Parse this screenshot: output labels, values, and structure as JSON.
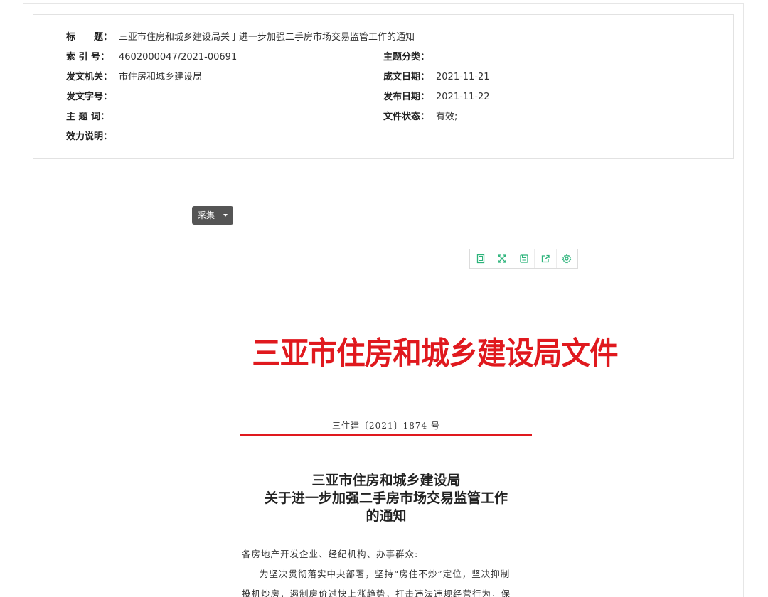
{
  "meta": {
    "title_label": "标　　题：",
    "title_value": "三亚市住房和城乡建设局关于进一步加强二手房市场交易监管工作的通知",
    "index_label": "索 引 号：",
    "index_value": "4602000047/2021-00691",
    "category_label": "主题分类：",
    "category_value": "",
    "issuer_label": "发文机关：",
    "issuer_value": "市住房和城乡建设局",
    "created_label": "成文日期：",
    "created_value": "2021-11-21",
    "docno_label": "发文字号：",
    "docno_value": "",
    "published_label": "发布日期：",
    "published_value": "2021-11-22",
    "keywords_label": "主 题 词：",
    "keywords_value": "",
    "status_label": "文件状态：",
    "status_value": "有效;",
    "validity_label": "效力说明：",
    "validity_value": ""
  },
  "collect_button": {
    "label": "采集"
  },
  "toolbar": {
    "icons": [
      "page-icon",
      "fullscreen-icon",
      "save-icon",
      "share-icon",
      "settings-icon"
    ],
    "accent_color": "#2bb37a"
  },
  "document": {
    "header": "三亚市住房和城乡建设局文件",
    "number": "三住建〔2021〕1874 号",
    "title_line1": "三亚市住房和城乡建设局",
    "title_line2": "关于进一步加强二手房市场交易监管工作",
    "title_line3": "的通知",
    "salutation": "各房地产开发企业、经纪机构、办事群众:",
    "body_line1": "为坚决贯彻落实中央部署，坚持“房住不炒”定位，坚决抑制",
    "body_line2": "投机炒房，遏制房价过快上涨趋势，打击违法违规经营行为，保",
    "header_color": "#e0191e"
  }
}
